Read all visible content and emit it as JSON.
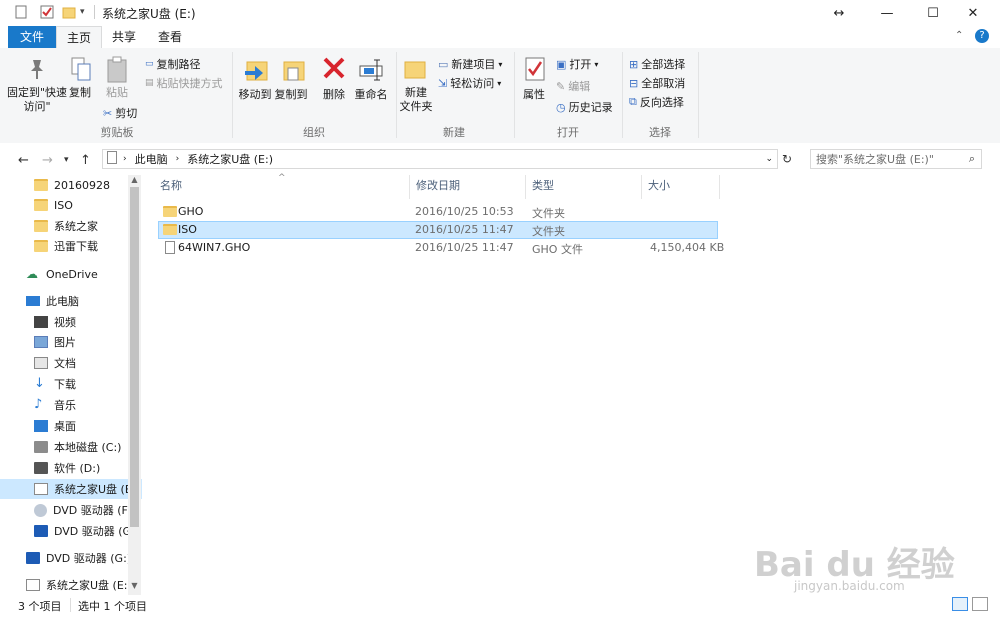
{
  "window": {
    "title": "系统之家U盘 (E:)",
    "controls": {
      "restore_arrows": "↔",
      "minimize": "—",
      "maximize": "☐",
      "close": "✕"
    }
  },
  "ribbon_tabs": [
    "文件",
    "主页",
    "共享",
    "查看"
  ],
  "ribbon": {
    "clipboard": {
      "label": "剪贴板",
      "pin": "固定到\"快速访问\"",
      "copy": "复制",
      "paste": "粘贴",
      "copy_path": "复制路径",
      "paste_shortcut": "粘贴快捷方式",
      "cut": "剪切"
    },
    "organize": {
      "label": "组织",
      "move_to": "移动到",
      "copy_to": "复制到",
      "delete": "删除",
      "rename": "重命名"
    },
    "new": {
      "label": "新建",
      "new_folder": "新建\n文件夹",
      "new_item": "新建项目",
      "easy_access": "轻松访问"
    },
    "open": {
      "label": "打开",
      "properties": "属性",
      "open": "打开",
      "edit": "编辑",
      "history": "历史记录"
    },
    "select": {
      "label": "选择",
      "select_all": "全部选择",
      "select_none": "全部取消",
      "invert": "反向选择"
    }
  },
  "address": {
    "crumbs": [
      "此电脑",
      "系统之家U盘 (E:)"
    ],
    "search_placeholder": "搜索\"系统之家U盘 (E:)\""
  },
  "nav": {
    "items": [
      {
        "label": "20160928",
        "icon": "folder-icon"
      },
      {
        "label": "ISO",
        "icon": "folder-icon"
      },
      {
        "label": "系统之家",
        "icon": "folder-icon"
      },
      {
        "label": "迅雷下载",
        "icon": "folder-icon"
      },
      {
        "label": "OneDrive",
        "icon": "cloud-icon"
      },
      {
        "label": "此电脑",
        "icon": "computer-icon"
      },
      {
        "label": "视频",
        "icon": "video-icon"
      },
      {
        "label": "图片",
        "icon": "picture-icon"
      },
      {
        "label": "文档",
        "icon": "document-icon"
      },
      {
        "label": "下载",
        "icon": "download-icon"
      },
      {
        "label": "音乐",
        "icon": "music-icon"
      },
      {
        "label": "桌面",
        "icon": "desktop-icon"
      },
      {
        "label": "本地磁盘 (C:)",
        "icon": "drive-icon"
      },
      {
        "label": "软件 (D:)",
        "icon": "drive-icon"
      },
      {
        "label": "系统之家U盘 (E:)",
        "icon": "usb-drive-icon"
      },
      {
        "label": "DVD 驱动器 (F:)",
        "icon": "dvd-icon"
      },
      {
        "label": "DVD 驱动器 (G:)",
        "icon": "dvd-icon"
      },
      {
        "label": "DVD 驱动器 (G:)",
        "icon": "dvd-icon"
      },
      {
        "label": "系统之家U盘 (E:)",
        "icon": "usb-drive-icon"
      }
    ]
  },
  "columns": [
    "名称",
    "修改日期",
    "类型",
    "大小"
  ],
  "files": [
    {
      "name": "GHO",
      "date": "2016/10/25 10:53",
      "type": "文件夹",
      "size": ""
    },
    {
      "name": "ISO",
      "date": "2016/10/25 11:47",
      "type": "文件夹",
      "size": ""
    },
    {
      "name": "64WIN7.GHO",
      "date": "2016/10/25 11:47",
      "type": "GHO 文件",
      "size": "4,150,404 KB"
    }
  ],
  "status": {
    "count": "3 个项目",
    "selected": "选中 1 个项目"
  },
  "watermark": {
    "brand": "Bai du 经验",
    "url": "jingyan.baidu.com"
  }
}
